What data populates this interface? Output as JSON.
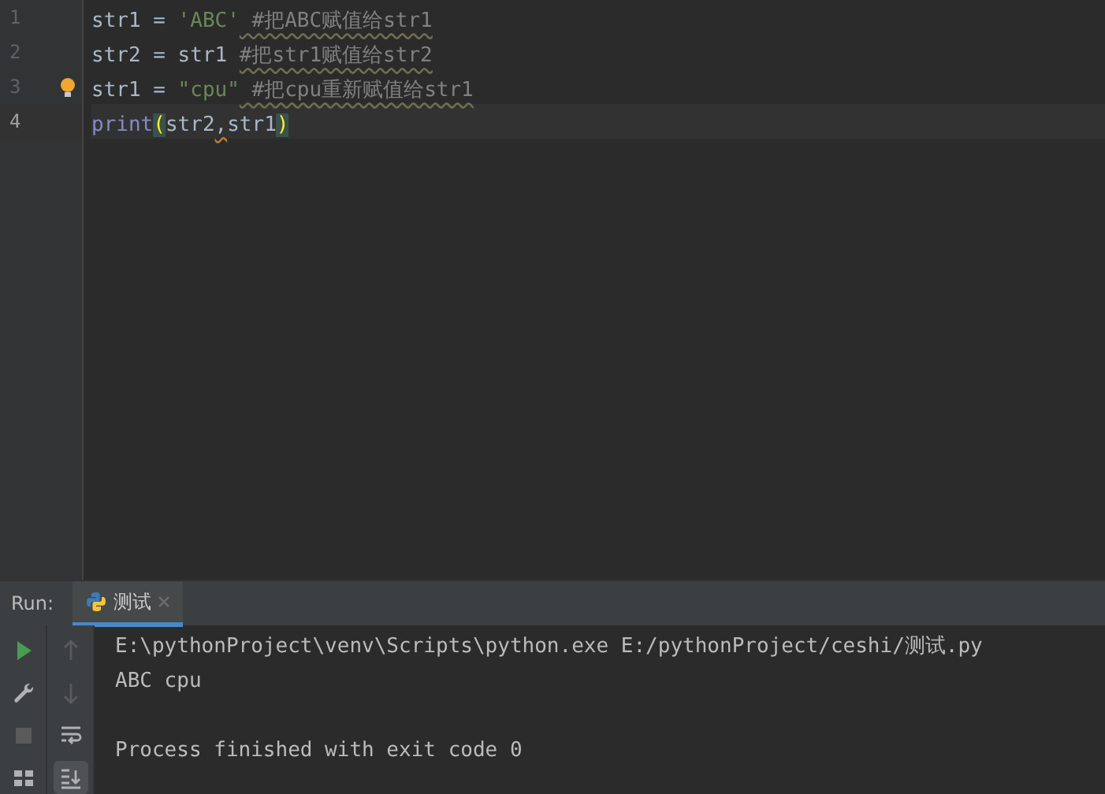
{
  "editor": {
    "lines": [
      {
        "number": "1",
        "current": false,
        "intention": false,
        "tokens": [
          {
            "kind": "plain",
            "text": "str1 = "
          },
          {
            "kind": "string",
            "text": "'ABC'"
          },
          {
            "kind": "comment",
            "text": " #把ABC赋值给str1"
          }
        ]
      },
      {
        "number": "2",
        "current": false,
        "intention": false,
        "tokens": [
          {
            "kind": "plain",
            "text": "str2 = str1 "
          },
          {
            "kind": "comment",
            "text": "#把str1赋值给str2"
          }
        ]
      },
      {
        "number": "3",
        "current": false,
        "intention": true,
        "tokens": [
          {
            "kind": "plain",
            "text": "str1 = "
          },
          {
            "kind": "string",
            "text": "\"cpu\""
          },
          {
            "kind": "comment",
            "text": " #把cpu重新赋值给str1"
          }
        ]
      },
      {
        "number": "4",
        "current": true,
        "intention": false,
        "tokens": [
          {
            "kind": "builtin",
            "text": "print"
          },
          {
            "kind": "brace",
            "text": "("
          },
          {
            "kind": "plain",
            "text": "str2"
          },
          {
            "kind": "warning",
            "text": ","
          },
          {
            "kind": "plain",
            "text": "str1"
          },
          {
            "kind": "brace",
            "text": ")"
          }
        ]
      }
    ]
  },
  "run": {
    "label": "Run:",
    "tab": {
      "title": "测试",
      "selected": true
    },
    "tools": [
      {
        "kind": "rerun",
        "disabled": false,
        "selected": false
      },
      {
        "kind": "settings",
        "disabled": false,
        "selected": false
      },
      {
        "kind": "stop",
        "disabled": true,
        "selected": false
      },
      {
        "kind": "layout",
        "disabled": false,
        "selected": false
      }
    ],
    "tools2": [
      {
        "kind": "up",
        "disabled": true,
        "selected": false
      },
      {
        "kind": "down",
        "disabled": true,
        "selected": false
      },
      {
        "kind": "wrap",
        "disabled": false,
        "selected": false
      },
      {
        "kind": "scroll",
        "disabled": false,
        "selected": true
      }
    ],
    "console": {
      "command": "E:\\pythonProject\\venv\\Scripts\\python.exe E:/pythonProject/ceshi/测试.py",
      "output": "ABC cpu",
      "exit_message": "Process finished with exit code 0"
    }
  }
}
